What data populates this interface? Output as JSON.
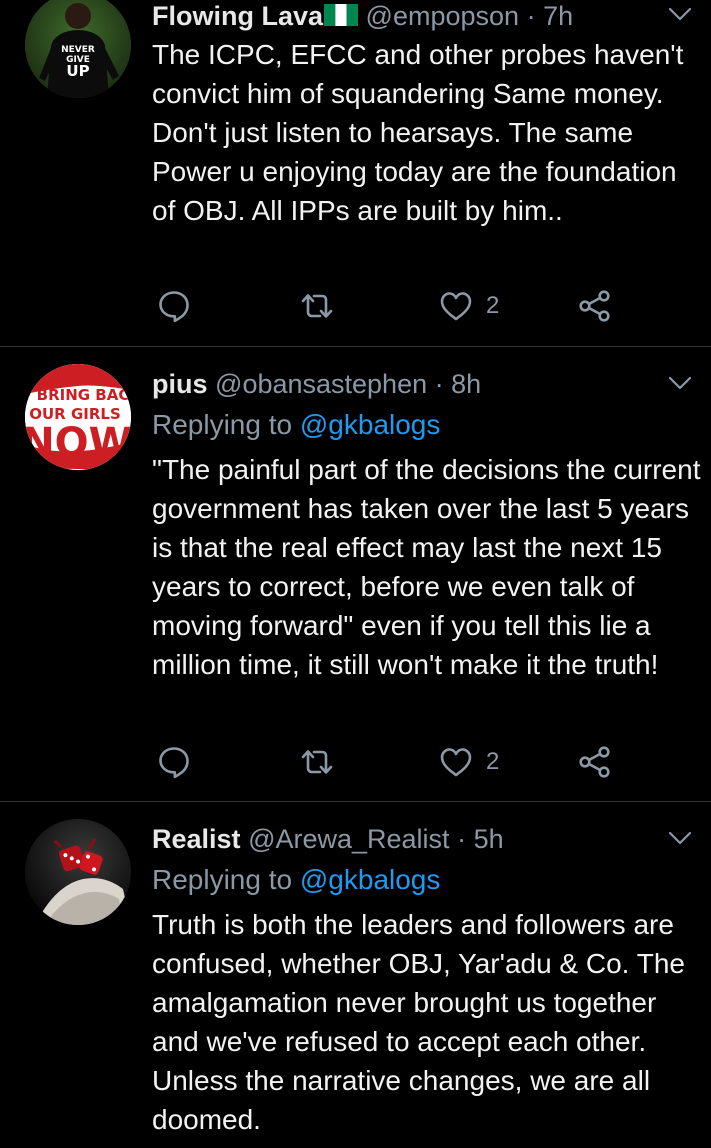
{
  "tweets": [
    {
      "name": "Flowing Lava",
      "handle": "@empopson",
      "separator": "·",
      "time": "7h",
      "avatar_text": [
        "NEVER",
        "GIVE",
        "UP"
      ],
      "body": "The ICPC, EFCC and other probes haven't convict him of squandering Same money. Don't just listen to hearsays. The same Power u enjoying today are the foundation of OBJ.  All IPPs are built by him..",
      "like_count": "2"
    },
    {
      "name": "pius",
      "handle": "@obansastephen",
      "separator": "·",
      "time": "8h",
      "avatar_text": [
        "BRING BAC",
        "OUR GIRLS",
        "NOW"
      ],
      "reply_prefix": "Replying to",
      "reply_to": "@gkbalogs",
      "body": "\"The painful part of the decisions the current government has taken over the last 5 years is that the real effect may last the next 15 years to correct, before we even talk of moving forward\" even if you tell this lie a million time, it still won't make it the truth!",
      "like_count": "2"
    },
    {
      "name": "Realist",
      "handle": "@Arewa_Realist",
      "separator": "·",
      "time": "5h",
      "reply_prefix": "Replying to",
      "reply_to": "@gkbalogs",
      "body": "Truth is both the leaders and followers are confused, whether OBJ, Yar'adu & Co. The amalgamation never brought us together and we've refused to accept each other. Unless the narrative changes, we are all doomed."
    }
  ],
  "colors": {
    "background": "#000000",
    "secondary_text": "#8b98a5",
    "link": "#1d9bf0",
    "divider": "#2f3336",
    "flag_green": "#008751"
  },
  "icons": [
    "chevron-down-icon",
    "reply-icon",
    "retweet-icon",
    "like-icon",
    "share-icon",
    "nigeria-flag-icon"
  ]
}
